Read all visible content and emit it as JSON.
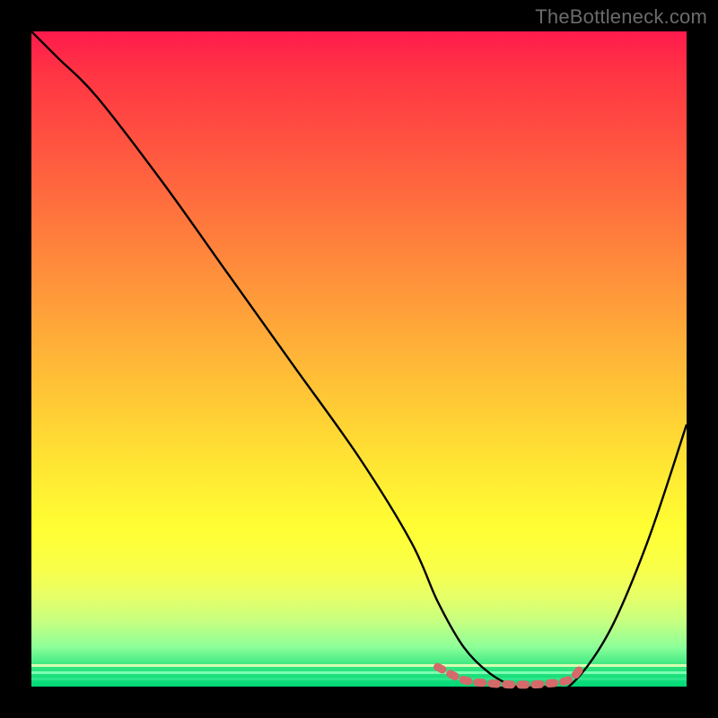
{
  "watermark": "TheBottleneck.com",
  "chart_data": {
    "type": "line",
    "title": "",
    "xlabel": "",
    "ylabel": "",
    "xlim": [
      0,
      100
    ],
    "ylim": [
      0,
      100
    ],
    "grid": false,
    "legend": false,
    "series": [
      {
        "name": "bottleneck-curve",
        "x": [
          0,
          4,
          10,
          20,
          30,
          40,
          50,
          58,
          62,
          66,
          70,
          74,
          78,
          82,
          88,
          94,
          100
        ],
        "y": [
          100,
          96,
          90,
          77,
          63,
          49,
          35,
          22,
          13,
          6,
          2,
          0,
          0,
          0,
          8,
          22,
          40
        ],
        "color": "#000000"
      },
      {
        "name": "optimal-range-marker",
        "x": [
          62,
          66,
          70,
          74,
          78,
          82,
          84
        ],
        "y": [
          3,
          1,
          0.5,
          0.3,
          0.4,
          1,
          3
        ],
        "color": "#d46a6a"
      }
    ],
    "annotations": []
  },
  "colors": {
    "background": "#000000",
    "gradient_top": "#ff1a4d",
    "gradient_bottom": "#00d977",
    "curve": "#000000",
    "marker": "#d46a6a",
    "watermark": "#6b6b6b"
  }
}
